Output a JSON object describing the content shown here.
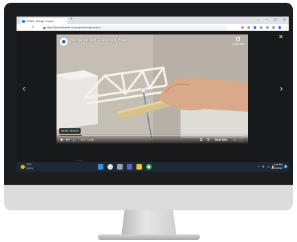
{
  "browser": {
    "tab_title": "CVSR - Bridge Project",
    "tab_close": "×",
    "new_tab": "+",
    "window_controls": [
      "⌄",
      "–",
      "☐",
      "✕"
    ],
    "url": "https://www.hellotello.com/projects/bridge-project"
  },
  "lightbox": {
    "close": "✕",
    "prev": "‹",
    "next": "›"
  },
  "video": {
    "title": "Bridge Project - Testing & Eval.",
    "copy_link": "Copy link",
    "more_videos": "MORE VIDEOS",
    "time": "0:27 / 3:46",
    "progress": 0.12,
    "provider": "YouTube"
  },
  "thumbnails": {
    "count": 6
  },
  "taskbar": {
    "weather_temp": "77°F",
    "weather_desc": "Sunny",
    "time": "3:46 PM",
    "date": "6/22/2022",
    "notifications": "3"
  },
  "colors": {
    "accent_blue": "#1a73e8",
    "progress_red": "#ff0000",
    "taskbar": "#1d2a33"
  }
}
